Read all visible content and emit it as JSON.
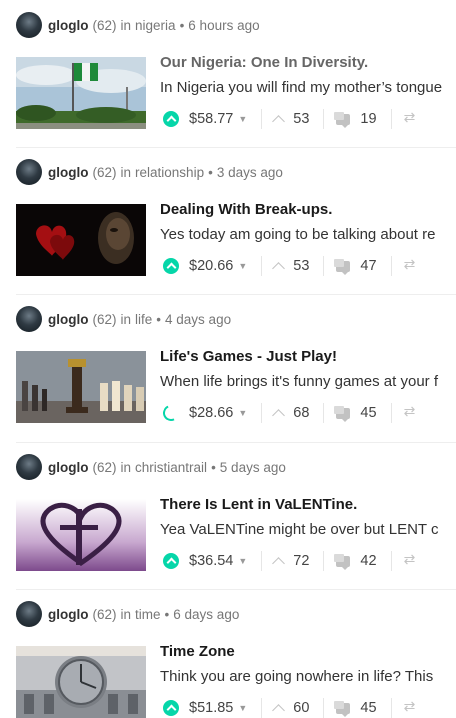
{
  "posts": [
    {
      "author": "gloglo",
      "reputation": "(62)",
      "category_prefix": "in",
      "category": "nigeria",
      "time": "6 hours ago",
      "title": "Our Nigeria: One In Diversity.",
      "snippet": "In Nigeria you will find my mother’s tongue",
      "payout": "$58.77",
      "votes": "53",
      "comments": "19",
      "payout_state": "paid",
      "thumb_icon": "nigeria-flag-thumbnail"
    },
    {
      "author": "gloglo",
      "reputation": "(62)",
      "category_prefix": "in",
      "category": "relationship",
      "time": "3 days ago",
      "title": "Dealing With Break-ups.",
      "snippet": "Yes today am going to be talking about re",
      "payout": "$20.66",
      "votes": "53",
      "comments": "47",
      "payout_state": "paid",
      "thumb_icon": "hearts-and-face-thumbnail"
    },
    {
      "author": "gloglo",
      "reputation": "(62)",
      "category_prefix": "in",
      "category": "life",
      "time": "4 days ago",
      "title": "Life's Games - Just Play!",
      "snippet": "When life brings it's funny games at your f",
      "payout": "$28.66",
      "votes": "68",
      "comments": "45",
      "payout_state": "loading",
      "thumb_icon": "chess-pieces-thumbnail"
    },
    {
      "author": "gloglo",
      "reputation": "(62)",
      "category_prefix": "in",
      "category": "christiantrail",
      "time": "5 days ago",
      "title": "There Is Lent in VaLENTine.",
      "snippet": "Yea VaLENTine might be over but LENT c",
      "payout": "$36.54",
      "votes": "72",
      "comments": "42",
      "payout_state": "paid",
      "thumb_icon": "heart-cross-thumbnail"
    },
    {
      "author": "gloglo",
      "reputation": "(62)",
      "category_prefix": "in",
      "category": "time",
      "time": "6 days ago",
      "title": "Time Zone",
      "snippet": "Think you are going nowhere in life? This",
      "payout": "$51.85",
      "votes": "60",
      "comments": "45",
      "payout_state": "paid",
      "thumb_icon": "clock-tower-thumbnail"
    }
  ],
  "colors": {
    "accent": "#06d6a9",
    "muted": "#777777",
    "title": "#1a1a1a"
  },
  "icons": {
    "payout": "payout-icon",
    "vote": "upvote-icon",
    "comment": "comment-icon",
    "reblog": "reblog-icon",
    "dropdown": "caret-down-icon"
  }
}
